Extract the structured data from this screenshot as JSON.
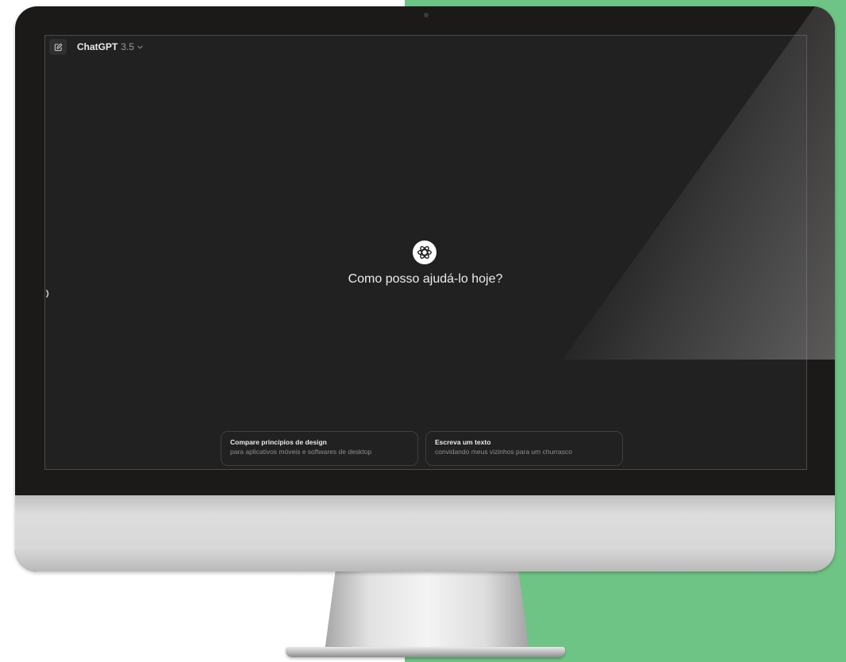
{
  "header": {
    "model_name": "ChatGPT",
    "model_version": "3.5",
    "new_chat_icon": "edit-icon",
    "dropdown_icon": "chevron-down-icon"
  },
  "main": {
    "logo_icon": "openai-logo-icon",
    "headline": "Como posso ajudá-lo hoje?"
  },
  "suggestions": [
    {
      "title": "Compare princípios de design",
      "subtitle": "para aplicativos móveis e softwares de desktop"
    },
    {
      "title": "Escreva um texto",
      "subtitle": "convidando meus vizinhos para um churrasco"
    }
  ],
  "colors": {
    "screen_background": "#212121",
    "text_primary": "#ececec",
    "text_secondary": "#8e8e8e",
    "card_border": "#3f3f3f",
    "green_background": "#6ec484"
  }
}
